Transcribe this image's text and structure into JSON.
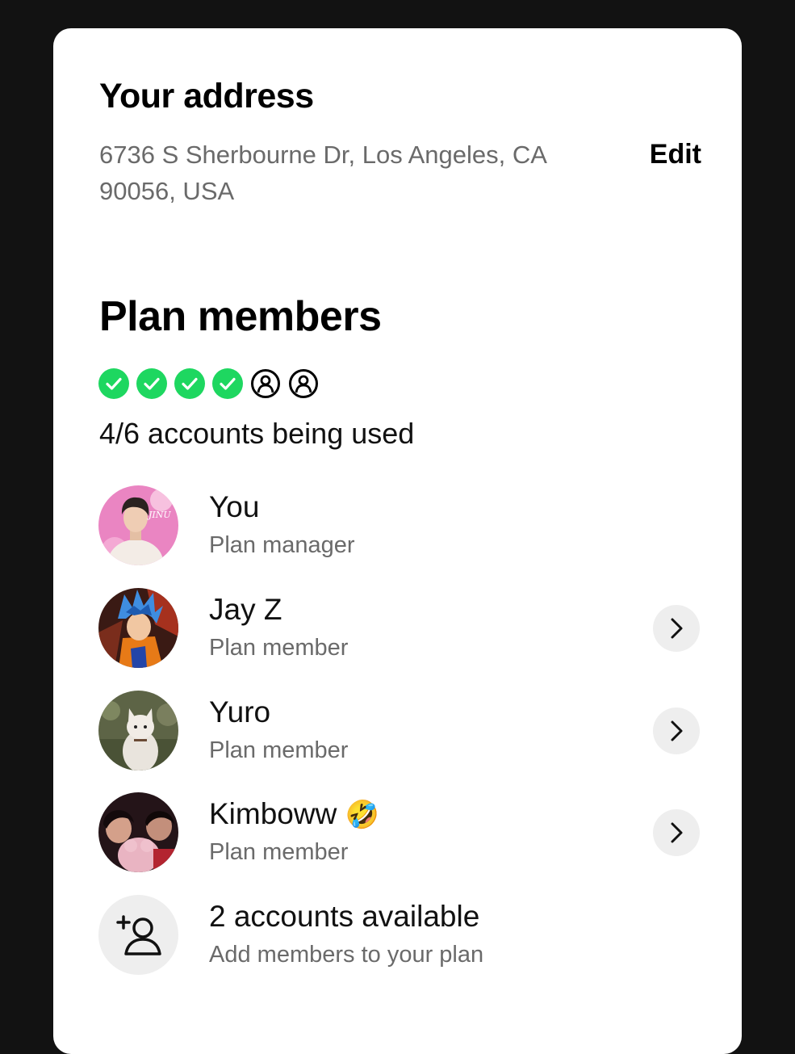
{
  "address": {
    "title": "Your address",
    "line": "6736 S Sherbourne Dr, Los Angeles, CA 90056, USA",
    "edit_label": "Edit"
  },
  "plan": {
    "title": "Plan members",
    "slots": [
      {
        "state": "used",
        "icon": "check-circle-icon"
      },
      {
        "state": "used",
        "icon": "check-circle-icon"
      },
      {
        "state": "used",
        "icon": "check-circle-icon"
      },
      {
        "state": "used",
        "icon": "check-circle-icon"
      },
      {
        "state": "empty",
        "icon": "person-circle-icon"
      },
      {
        "state": "empty",
        "icon": "person-circle-icon"
      }
    ],
    "usage_text": "4/6 accounts being used",
    "members": [
      {
        "name": "You",
        "role": "Plan manager",
        "chevron": false
      },
      {
        "name": "Jay Z",
        "role": "Plan member",
        "chevron": true
      },
      {
        "name": "Yuro",
        "role": "Plan member",
        "chevron": true
      },
      {
        "name": "Kimboww",
        "emoji": "🤣",
        "role": "Plan member",
        "chevron": true
      }
    ],
    "available": {
      "title": "2 accounts available",
      "subtitle": "Add members to your plan"
    }
  },
  "colors": {
    "used": "#1ed760",
    "background": "#121212",
    "card": "#ffffff",
    "secondary_text": "#6a6a6a"
  }
}
